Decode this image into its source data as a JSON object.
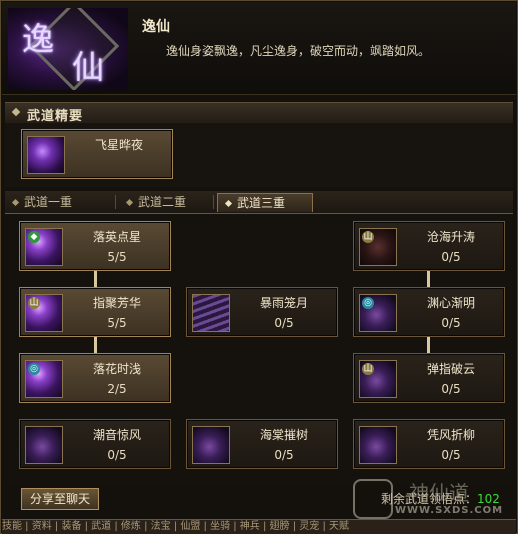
{
  "header": {
    "emblem_char1": "逸",
    "emblem_char2": "仙",
    "title": "逸仙",
    "description": "逸仙身姿飘逸，凡尘逸身，破空而动，飒踏如风。"
  },
  "essence": {
    "section_label": "武道精要",
    "card": {
      "name": "飞星晔夜"
    }
  },
  "tabs": [
    {
      "label": "武道一重",
      "active": false
    },
    {
      "label": "武道二重",
      "active": false
    },
    {
      "label": "武道三重",
      "active": true
    }
  ],
  "tree": {
    "luoying": {
      "name": "落英点星",
      "level": "5/5"
    },
    "zhiju": {
      "name": "指聚芳华",
      "level": "5/5"
    },
    "luohua": {
      "name": "落花时浅",
      "level": "2/5"
    },
    "chaoyin": {
      "name": "潮音惊风",
      "level": "0/5"
    },
    "baoyu": {
      "name": "暴雨笼月",
      "level": "0/5"
    },
    "haitang": {
      "name": "海棠摧树",
      "level": "0/5"
    },
    "canghai": {
      "name": "沧海升涛",
      "level": "0/5"
    },
    "yuanxin": {
      "name": "渊心渐明",
      "level": "0/5"
    },
    "tanzhi": {
      "name": "弹指破云",
      "level": "0/5"
    },
    "pingfeng": {
      "name": "凭风折柳",
      "level": "0/5"
    }
  },
  "footer": {
    "share_label": "分享至聊天",
    "remaining_label": "剩余武道领悟点：",
    "remaining_value": "102"
  },
  "watermark": {
    "url": "WWW.SXDS.COM",
    "cn": "神仙道"
  },
  "bottom_strip": "技能 | 资料 | 装备 | 武道 | 修炼 | 法宝 | 仙盟 | 坐骑 | 神兵 | 翅膀 | 灵宠 | 天赋",
  "colors": {
    "accent_green": "#3cdc3c",
    "card_border": "#a08458"
  }
}
